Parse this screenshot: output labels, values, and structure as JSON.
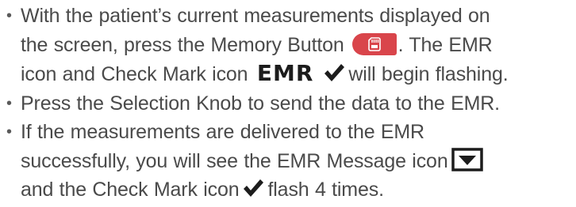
{
  "bullets": [
    {
      "lines": [
        "With the patient’s current measurements displayed on",
        "the screen, press the Memory Button",
        ". The EMR",
        "icon and Check Mark icon",
        "will begin flashing."
      ]
    },
    {
      "lines": [
        "Press the Selection Knob to send the data to the EMR."
      ]
    },
    {
      "lines": [
        "If the measurements are delivered to the EMR",
        "successfully, you will see the EMR Message icon",
        "and the Check Mark icon",
        "flash 4 times."
      ]
    }
  ],
  "icons": {
    "memory_button": {
      "name": "memory-button-icon",
      "color": "#d9454b"
    },
    "emr_label": "EMR",
    "check_mark": {
      "name": "check-mark-icon",
      "color": "#1c1c1c"
    },
    "envelope": {
      "name": "emr-message-icon",
      "color": "#1c1c1c"
    }
  }
}
